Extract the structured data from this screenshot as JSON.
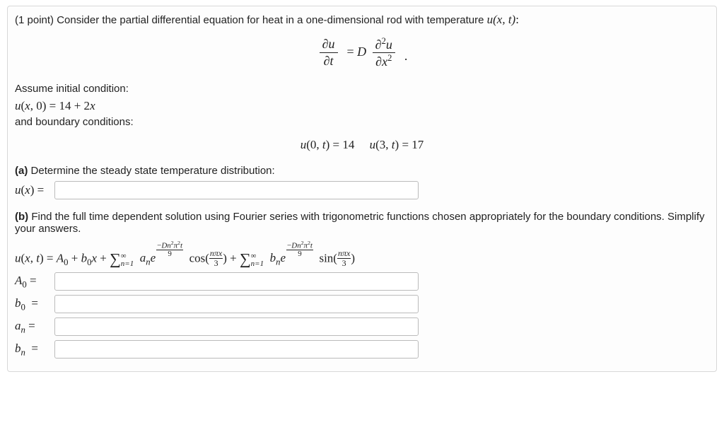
{
  "points": "(1 point)",
  "intro": "Consider the partial differential equation for heat in a one-dimensional rod with temperature ",
  "u_xt": "u(x, t)",
  "assume_ic": "Assume initial condition:",
  "ic_eq": "u(x, 0) = 14 + 2x",
  "and_bc": "and boundary conditions:",
  "bc_left": "u(0, t) = 14",
  "bc_right": "u(3, t) = 17",
  "part_a_label": "(a)",
  "part_a_text": "Determine the steady state temperature distribution:",
  "ux_label": "u(x) = ",
  "part_b_label": "(b)",
  "part_b_text": "Find the full time dependent solution using Fourier series with trigonometric functions chosen appropriately for the boundary conditions. Simplify your answers.",
  "labels": {
    "A0": "A₀ = ",
    "b0": "b₀ = ",
    "an": "aₙ = ",
    "bn": "bₙ = "
  }
}
